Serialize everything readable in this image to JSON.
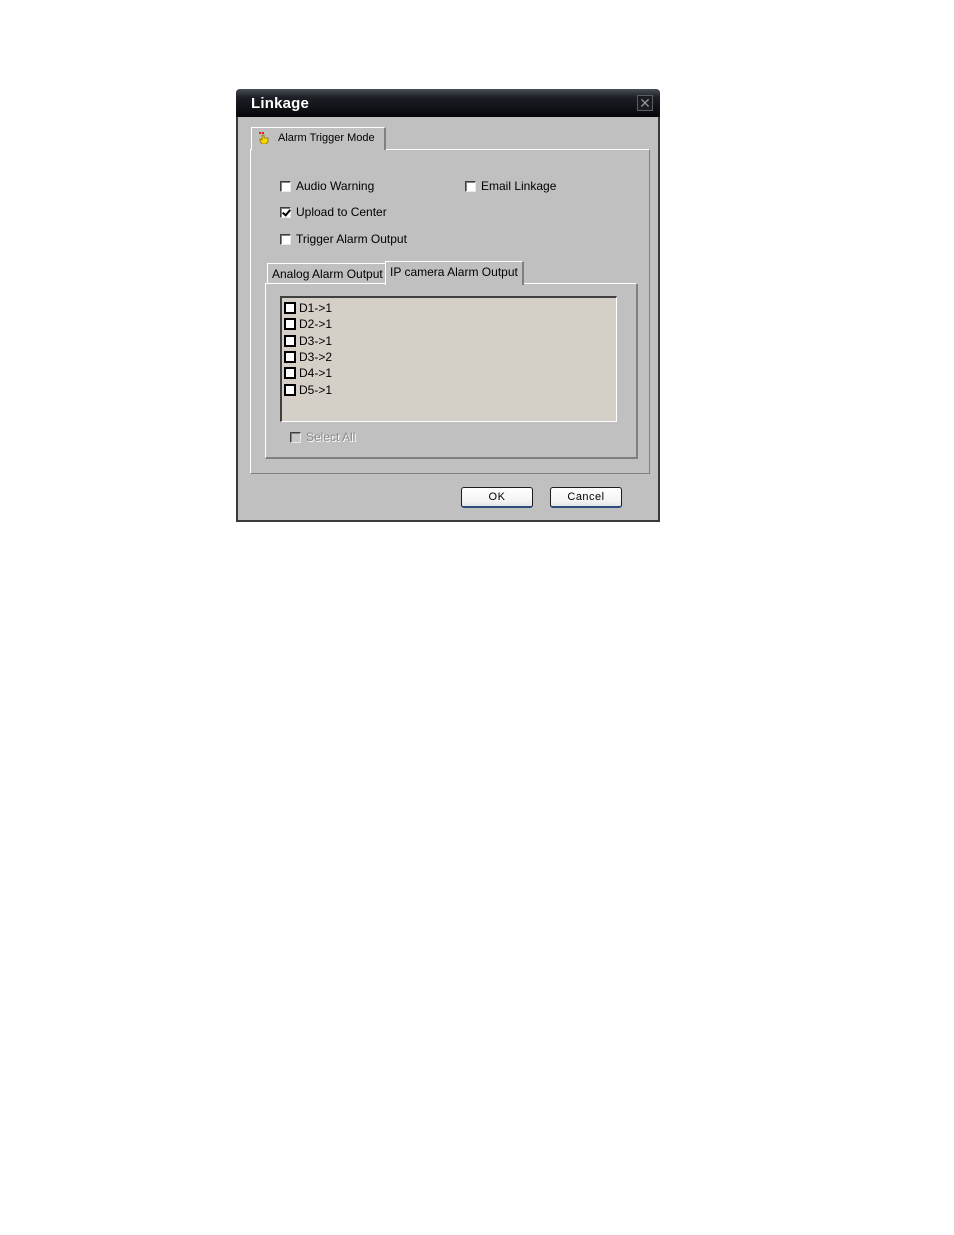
{
  "dialog": {
    "title": "Linkage",
    "close_icon": "close-icon"
  },
  "outer_tab": {
    "label": "Alarm Trigger Mode",
    "icon": "hand-pointer-icon"
  },
  "options": {
    "audio_warning": {
      "label": "Audio Warning",
      "checked": false
    },
    "email_linkage": {
      "label": "Email Linkage",
      "checked": false
    },
    "upload_to_center": {
      "label": "Upload to Center",
      "checked": true
    },
    "trigger_alarm_output": {
      "label": "Trigger Alarm Output",
      "checked": false
    }
  },
  "inner_tabs": [
    {
      "label": "Analog Alarm Output",
      "active": false
    },
    {
      "label": "IP camera Alarm Output",
      "active": true
    }
  ],
  "outputs": [
    {
      "label": "D1->1",
      "checked": false
    },
    {
      "label": "D2->1",
      "checked": false
    },
    {
      "label": "D3->1",
      "checked": false
    },
    {
      "label": "D3->2",
      "checked": false
    },
    {
      "label": "D4->1",
      "checked": false
    },
    {
      "label": "D5->1",
      "checked": false
    }
  ],
  "select_all": {
    "label": "Select All",
    "checked": false,
    "disabled": true
  },
  "buttons": {
    "ok": "OK",
    "cancel": "Cancel"
  }
}
